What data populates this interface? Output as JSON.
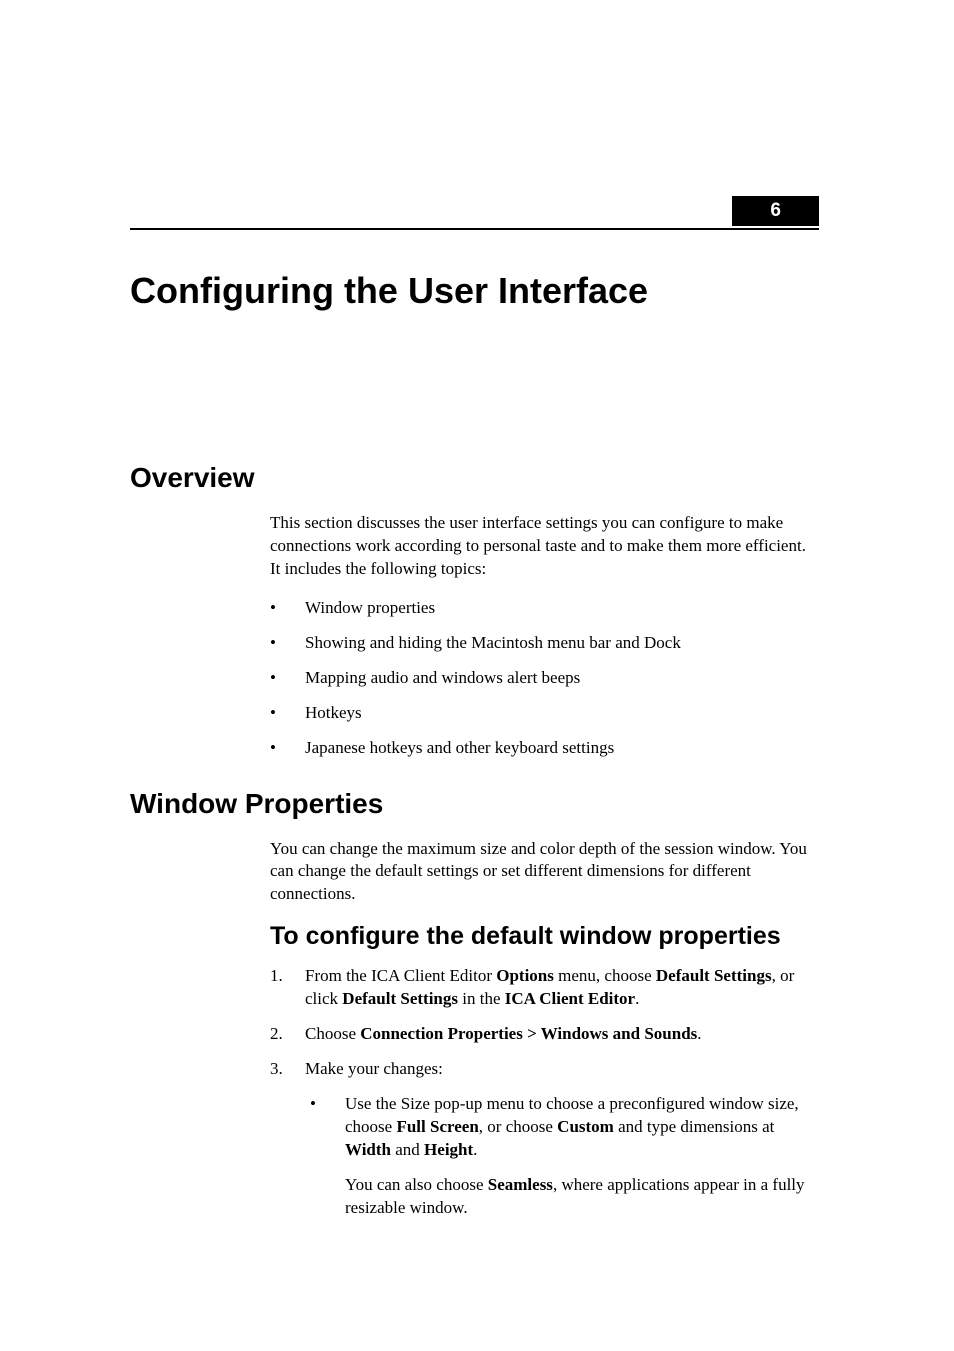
{
  "chapter_number": "6",
  "chapter_title": "Configuring the User Interface",
  "overview": {
    "heading": "Overview",
    "intro": "This section discusses the user interface settings you can configure to make connections work according to personal taste and to make them more efficient. It includes the following topics:",
    "bullets": [
      "Window properties",
      "Showing and hiding the Macintosh menu bar and Dock",
      "Mapping audio and windows alert beeps",
      "Hotkeys",
      "Japanese hotkeys and other keyboard settings"
    ]
  },
  "window_props": {
    "heading": "Window Properties",
    "intro": "You can change the maximum size and color depth of the session window. You can change the default settings or set different dimensions for different connections.",
    "sub_heading": "To configure the default window properties",
    "steps": {
      "s1_a": "From the ICA Client Editor ",
      "s1_b": "Options",
      "s1_c": " menu, choose ",
      "s1_d": "Default Settings",
      "s1_e": ", or click ",
      "s1_f": "Default Settings",
      "s1_g": " in the ",
      "s1_h": "ICA Client Editor",
      "s1_i": ".",
      "s2_a": "Choose ",
      "s2_b": "Connection Properties > Windows and Sounds",
      "s2_c": ".",
      "s3_a": "Make your changes:",
      "s3_sub_a": "Use the Size pop-up menu to choose a preconfigured window size, choose ",
      "s3_sub_b": "Full Screen",
      "s3_sub_c": ", or choose ",
      "s3_sub_d": "Custom",
      "s3_sub_e": " and type dimensions at ",
      "s3_sub_f": "Width",
      "s3_sub_g": " and ",
      "s3_sub_h": "Height",
      "s3_sub_i": ".",
      "s3_p2_a": "You can also choose ",
      "s3_p2_b": "Seamless",
      "s3_p2_c": ", where applications appear in a fully resizable window."
    }
  }
}
